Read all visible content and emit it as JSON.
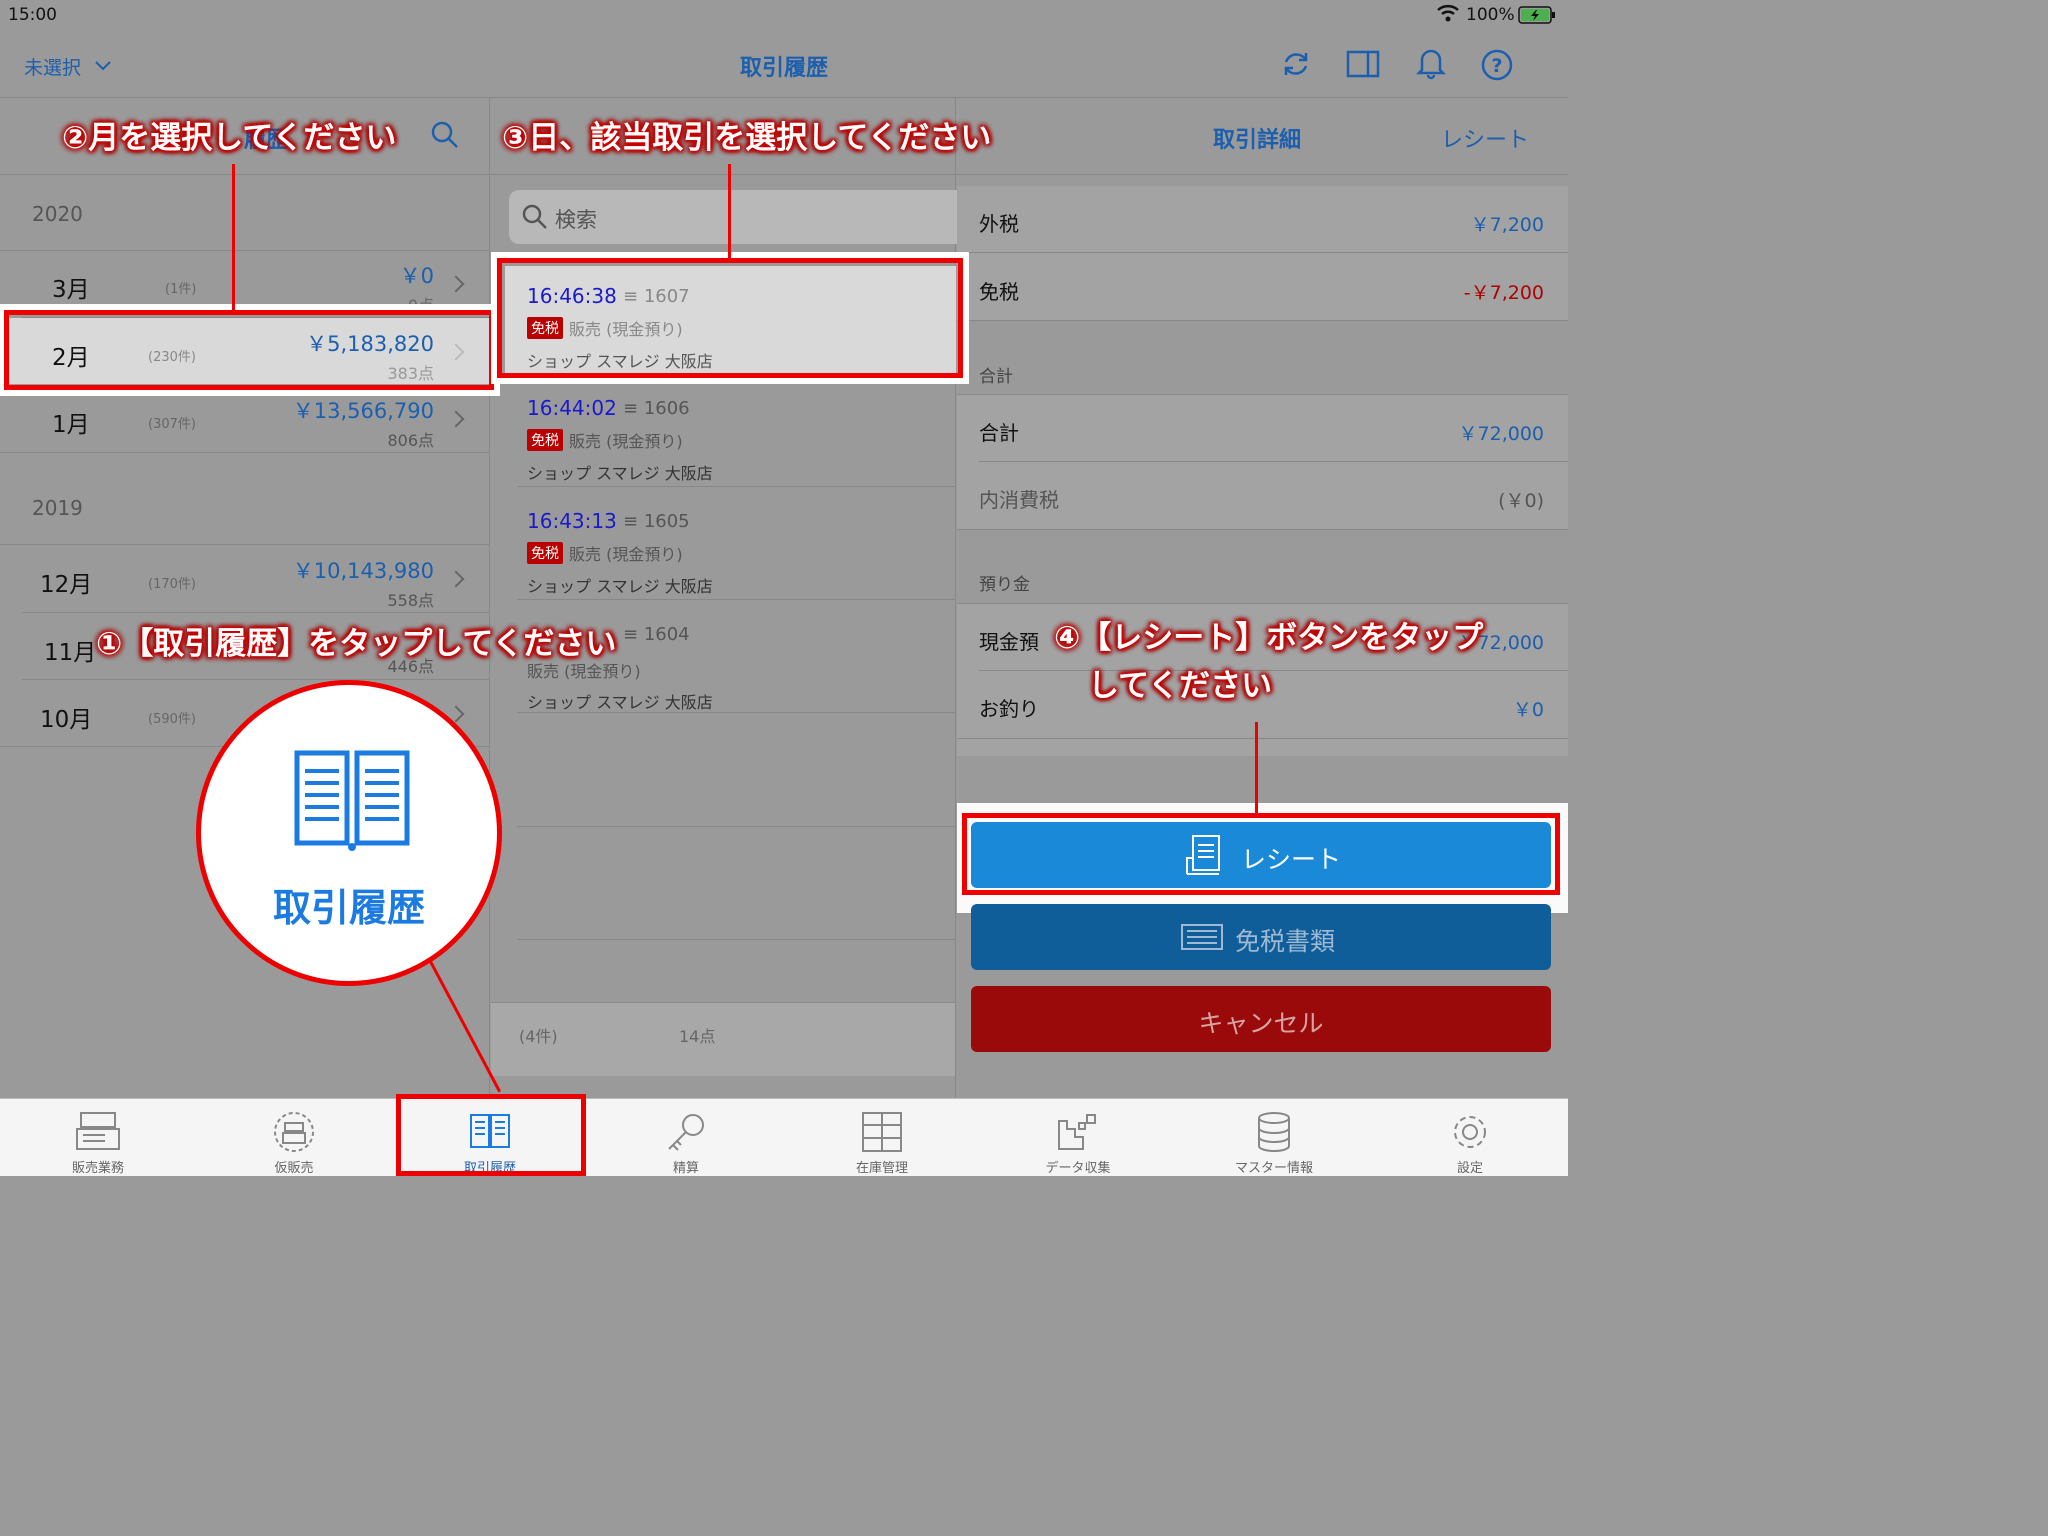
{
  "status_bar": {
    "time": "15:00",
    "battery": "100%"
  },
  "header": {
    "store_select": "未選択",
    "title": "取引履歴"
  },
  "left_pane": {
    "search_title_partial": "履歴",
    "years": [
      {
        "year": "2020",
        "months": [
          {
            "month": "3月",
            "count": "(1件)",
            "amount": "￥0",
            "points": "0点"
          },
          {
            "month": "2月",
            "count": "(230件)",
            "amount": "￥5,183,820",
            "points": "383点"
          },
          {
            "month": "1月",
            "count": "(307件)",
            "amount": "￥13,566,790",
            "points": "806点"
          }
        ]
      },
      {
        "year": "2019",
        "months": [
          {
            "month": "12月",
            "count": "(170件)",
            "amount": "￥10,143,980",
            "points": "558点"
          },
          {
            "month": "11月",
            "count": "",
            "amount": "",
            "points": "446点"
          },
          {
            "month": "10月",
            "count": "(590件)",
            "amount": "",
            "points": ""
          }
        ]
      }
    ]
  },
  "middle_pane": {
    "search_placeholder": "検索",
    "transactions": [
      {
        "time": "16:46:38",
        "number": "1607",
        "badge": "免税",
        "type": "販売 (現金預り)",
        "shop": "ショップ スマレジ 大阪店"
      },
      {
        "time": "16:44:02",
        "number": "1606",
        "badge": "免税",
        "type": "販売 (現金預り)",
        "shop": "ショップ スマレジ 大阪店"
      },
      {
        "time": "16:43:13",
        "number": "1605",
        "badge": "免税",
        "type": "販売 (現金預り)",
        "shop": "ショップ スマレジ 大阪店"
      },
      {
        "time": "",
        "number": "1604",
        "badge": "",
        "type": "販売 (現金預り)",
        "shop": "ショップ スマレジ 大阪店"
      }
    ],
    "footer": {
      "count": "(4件)",
      "points": "14点"
    }
  },
  "right_pane": {
    "tab_detail": "取引詳細",
    "tab_receipt": "レシート",
    "rows": {
      "outer_tax_label": "外税",
      "outer_tax_value": "￥7,200",
      "tax_free_label": "免税",
      "tax_free_value": "-￥7,200",
      "total_section": "合計",
      "total_label": "合計",
      "total_value": "￥72,000",
      "inner_tax_label": "内消費税",
      "inner_tax_value": "(￥0)",
      "deposit_section": "預り金",
      "cash_label": "現金預",
      "cash_value": "￥72,000",
      "change_label": "お釣り",
      "change_value": "￥0"
    },
    "buttons": {
      "receipt": "レシート",
      "tax_free_docs": "免税書類",
      "cancel": "キャンセル"
    }
  },
  "annotations": {
    "step1": "①【取引履歴】をタップしてください",
    "step2": "②月を選択してください",
    "step3": "③日、該当取引を選択してください",
    "step4_line1": "④【レシート】ボタンをタップ",
    "step4_line2": "してください",
    "zoom_label": "取引履歴"
  },
  "tabbar": [
    {
      "label": "販売業務",
      "icon": "register-icon"
    },
    {
      "label": "仮販売",
      "icon": "temp-sale-icon"
    },
    {
      "label": "取引履歴",
      "icon": "book-icon"
    },
    {
      "label": "精算",
      "icon": "key-icon"
    },
    {
      "label": "在庫管理",
      "icon": "cabinet-icon"
    },
    {
      "label": "データ収集",
      "icon": "data-icon"
    },
    {
      "label": "マスター情報",
      "icon": "database-icon"
    },
    {
      "label": "設定",
      "icon": "gear-icon"
    }
  ],
  "colors": {
    "accent": "#1c5fae",
    "highlight": "#e00000",
    "receipt_button": "#1a8ad8",
    "tax_button": "#0f5e9a",
    "cancel_button": "#9a0a0a"
  }
}
